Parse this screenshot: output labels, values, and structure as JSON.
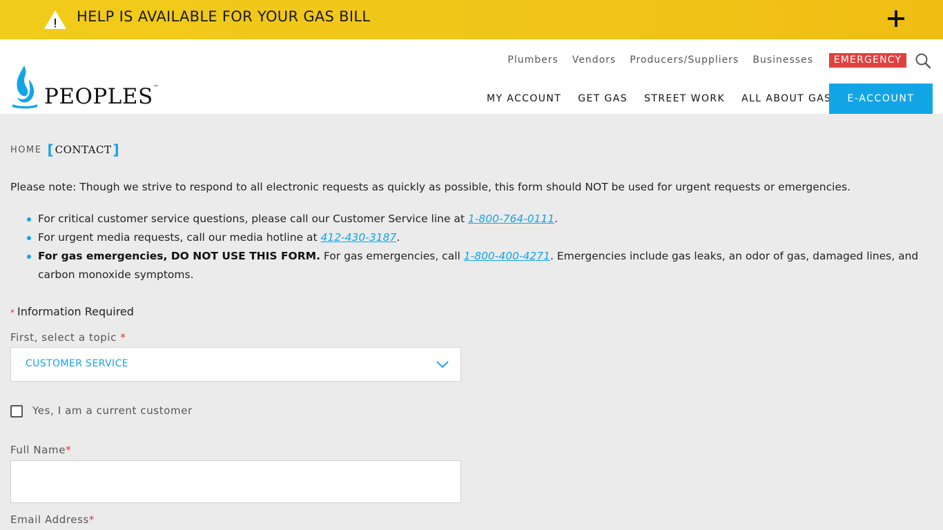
{
  "alert": {
    "text": "HELP IS AVAILABLE FOR YOUR GAS BILL",
    "icon": "warning-icon",
    "expand_icon": "plus-icon"
  },
  "brand": {
    "name": "PEOPLES",
    "tm": "™"
  },
  "utility_nav": [
    "Plumbers",
    "Vendors",
    "Producers/Suppliers",
    "Businesses"
  ],
  "emergency_label": "EMERGENCY",
  "main_nav": [
    "MY ACCOUNT",
    "GET GAS",
    "STREET WORK",
    "ALL ABOUT GAS"
  ],
  "eaccount_label": "E-ACCOUNT",
  "breadcrumb": {
    "home": "HOME",
    "current": "CONTACT"
  },
  "note": "Please note: Though we strive to respond to all electronic requests as quickly as possible, this form should NOT be used for urgent requests or emergencies.",
  "bullets": {
    "b1": {
      "pre": "For critical customer service questions, please call our Customer Service line at ",
      "link": "1-800-764-0111",
      "post": "."
    },
    "b2": {
      "pre": "For urgent media requests, call our media hotline at ",
      "link": "412-430-3187",
      "post": "."
    },
    "b3": {
      "bold": "For gas emergencies, DO NOT USE THIS FORM.",
      "pre": " For gas emergencies, call ",
      "link": "1-800-400-4271",
      "post": ". Emergencies include gas leaks, an odor of gas, damaged lines, and carbon monoxide symptoms."
    }
  },
  "form": {
    "required_star": "*",
    "required_note": "Information Required",
    "topic_label": "First, select a topic",
    "topic_value": "CUSTOMER SERVICE",
    "current_customer_label": "Yes, I am a current customer",
    "full_name_label": "Full Name",
    "full_name_value": "",
    "email_label": "Email Address"
  },
  "colors": {
    "alert_yellow": "#f2cc1a",
    "brand_blue": "#12a5e6",
    "emergency_red": "#e0413f"
  }
}
